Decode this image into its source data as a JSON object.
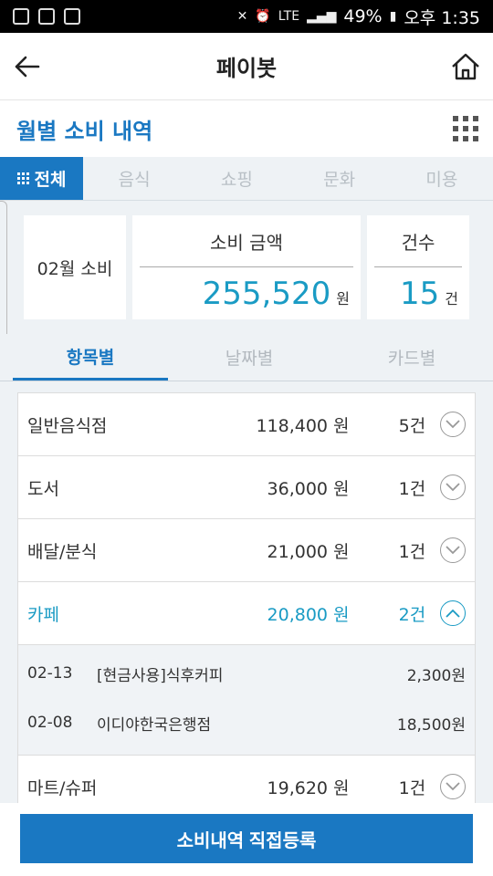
{
  "status_bar": {
    "battery": "49%",
    "time": "오후 1:35",
    "network": "LTE"
  },
  "header": {
    "title": "페이봇",
    "back_icon": "arrow-left-icon",
    "home_icon": "home-icon"
  },
  "sub_header": {
    "title": "월별 소비 내역",
    "menu_icon": "grid-menu-icon"
  },
  "category_tabs": [
    {
      "label": "전체",
      "active": true
    },
    {
      "label": "음식",
      "active": false
    },
    {
      "label": "쇼핑",
      "active": false
    },
    {
      "label": "문화",
      "active": false
    },
    {
      "label": "미용",
      "active": false
    }
  ],
  "summary": {
    "month_label": "02월 소비",
    "amount_header": "소비 금액",
    "amount_value": "255,520",
    "amount_unit": "원",
    "count_header": "건수",
    "count_value": "15",
    "count_unit": "건"
  },
  "view_tabs": [
    {
      "label": "항목별",
      "active": true
    },
    {
      "label": "날짜별",
      "active": false
    },
    {
      "label": "카드별",
      "active": false
    }
  ],
  "categories": [
    {
      "name": "일반음식점",
      "amount": "118,400 원",
      "count": "5건",
      "expanded": false
    },
    {
      "name": "도서",
      "amount": "36,000 원",
      "count": "1건",
      "expanded": false
    },
    {
      "name": "배달/분식",
      "amount": "21,000 원",
      "count": "1건",
      "expanded": false
    },
    {
      "name": "카페",
      "amount": "20,800 원",
      "count": "2건",
      "expanded": true
    },
    {
      "name": "마트/슈퍼",
      "amount": "19,620 원",
      "count": "1건",
      "expanded": false
    }
  ],
  "cafe_details": [
    {
      "date": "02-13",
      "desc": "[현금사용]식후커피",
      "amount": "2,300원"
    },
    {
      "date": "02-08",
      "desc": "이디야한국은행점",
      "amount": "18,500원"
    }
  ],
  "bottom": {
    "register_label": "소비내역 직접등록"
  },
  "colors": {
    "accent": "#1a78c2",
    "highlight": "#1a9bc4",
    "background": "#eef2f5"
  }
}
